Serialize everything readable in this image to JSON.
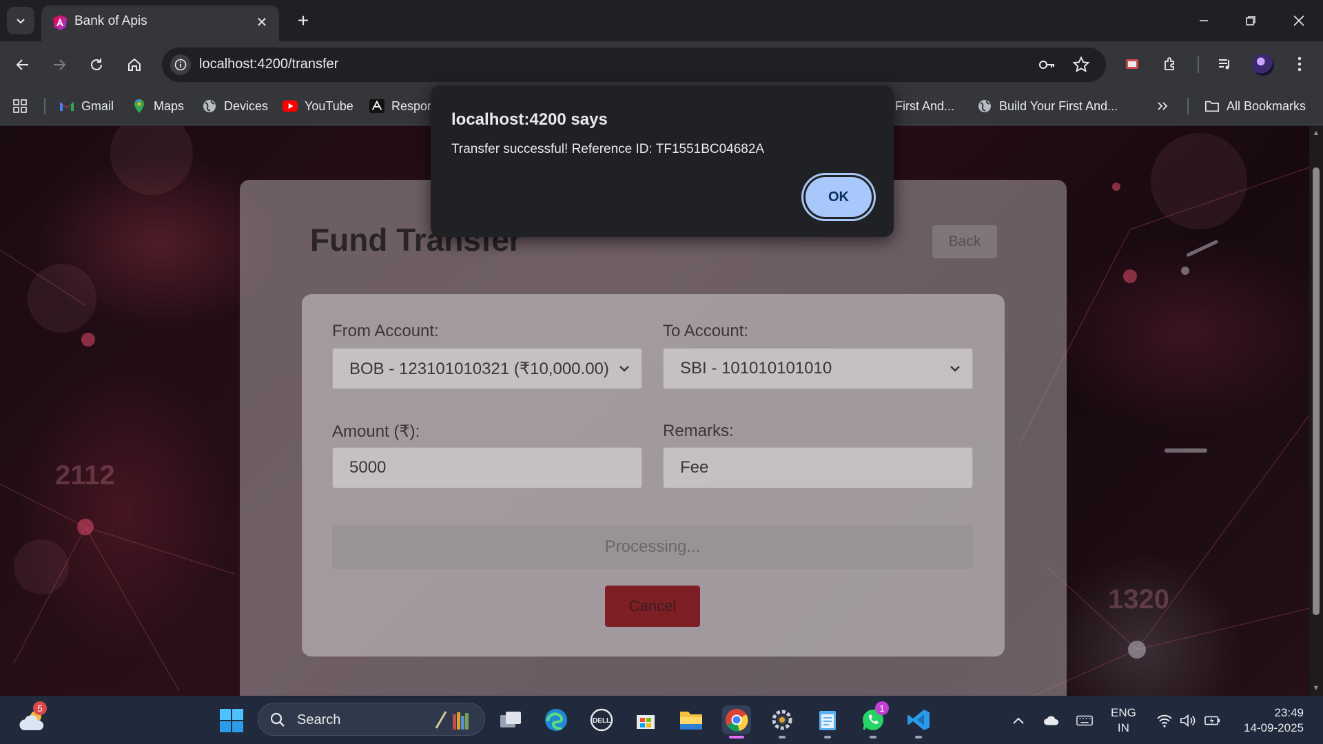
{
  "browser": {
    "tab_title": "Bank of Apis",
    "url": "localhost:4200/transfer",
    "bookmarks": [
      {
        "label": "Gmail"
      },
      {
        "label": "Maps"
      },
      {
        "label": "Devices"
      },
      {
        "label": "YouTube"
      },
      {
        "label": "Respor"
      },
      {
        "label": "r First And..."
      },
      {
        "label": "Build Your First And..."
      }
    ],
    "all_bookmarks": "All Bookmarks"
  },
  "page": {
    "title": "Fund Transfer",
    "back_label": "Back",
    "from_label": "From Account:",
    "from_value": "BOB - 123101010321 (₹10,000.00)",
    "to_label": "To Account:",
    "to_value": "SBI - 101010101010",
    "amount_label": "Amount (₹):",
    "amount_value": "5000",
    "remarks_label": "Remarks:",
    "remarks_value": "Fee",
    "processing_label": "Processing...",
    "cancel_label": "Cancel",
    "background_numbers": [
      "2112",
      "1320"
    ]
  },
  "dialog": {
    "title": "localhost:4200 says",
    "message": "Transfer successful! Reference ID: TF1551BC04682A",
    "ok_label": "OK"
  },
  "taskbar": {
    "weather_badge": "5",
    "search_label": "Search",
    "whatsapp_badge": "1",
    "lang_line1": "ENG",
    "lang_line2": "IN",
    "time": "23:49",
    "date": "14-09-2025"
  },
  "colors": {
    "dialog_bg": "#202124",
    "ok_button": "#a8c7fa",
    "cancel_button": "#7e1f25",
    "taskbar_bg": "#202a3c"
  }
}
